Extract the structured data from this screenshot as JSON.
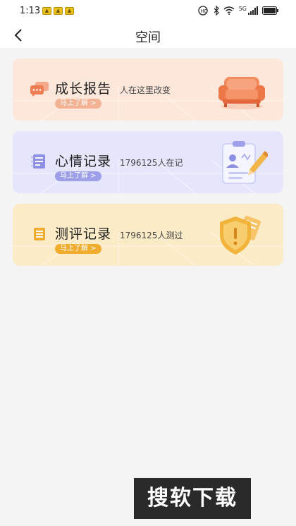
{
  "status_bar": {
    "time": "1:13",
    "network": "5G",
    "notification_icons": [
      "notif-icon",
      "notif-icon",
      "notif-icon"
    ]
  },
  "header": {
    "title": "空间"
  },
  "cards": [
    {
      "title": "成长报告",
      "subtitle": "人在这里改变",
      "button": "马上了解 >",
      "accent": "#f08a5d"
    },
    {
      "title": "心情记录",
      "subtitle": "1796125人在记",
      "button": "马上了解 >",
      "accent": "#8c8fe3"
    },
    {
      "title": "测评记录",
      "subtitle": "1796125人测过",
      "button": "马上了解 >",
      "accent": "#f0ac2d"
    }
  ],
  "watermark": {
    "text": "搜软下载"
  }
}
